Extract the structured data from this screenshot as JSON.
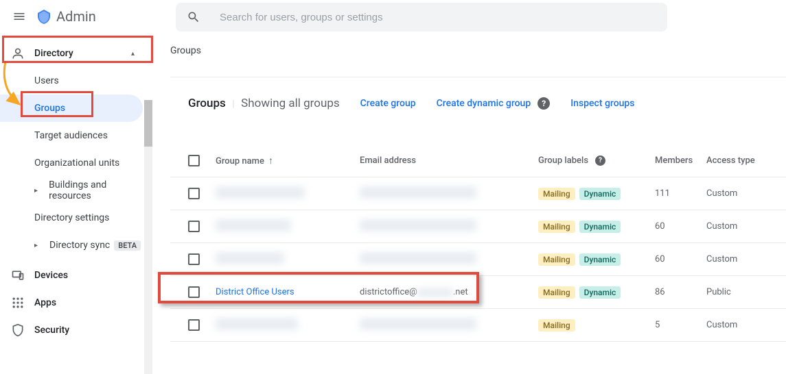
{
  "header": {
    "product": "Admin",
    "search_placeholder": "Search for users, groups or settings"
  },
  "sidebar": {
    "top": {
      "label": "Directory"
    },
    "items": [
      {
        "label": "Users"
      },
      {
        "label": "Groups"
      },
      {
        "label": "Target audiences"
      },
      {
        "label": "Organizational units"
      },
      {
        "label": "Buildings and resources"
      },
      {
        "label": "Directory settings"
      },
      {
        "label": "Directory sync",
        "badge": "BETA"
      }
    ],
    "sections": [
      {
        "label": "Devices"
      },
      {
        "label": "Apps"
      },
      {
        "label": "Security"
      }
    ]
  },
  "content": {
    "breadcrumb": "Groups",
    "title": "Groups",
    "subtitle": "Showing all groups",
    "actions": {
      "create": "Create group",
      "create_dynamic": "Create dynamic group",
      "inspect": "Inspect groups"
    },
    "columns": {
      "name": "Group name",
      "email": "Email address",
      "labels": "Group labels",
      "members": "Members",
      "access": "Access type"
    },
    "labels": {
      "mailing": "Mailing",
      "dynamic": "Dynamic"
    },
    "rows": [
      {
        "name": "",
        "email": "",
        "mailing": true,
        "dynamic": true,
        "members": "111",
        "access": "Custom",
        "blurred": true
      },
      {
        "name": "",
        "email": "",
        "mailing": true,
        "dynamic": true,
        "members": "60",
        "access": "Custom",
        "blurred": true
      },
      {
        "name": "",
        "email": "",
        "mailing": true,
        "dynamic": true,
        "members": "60",
        "access": "Custom",
        "blurred": true
      },
      {
        "name": "District Office Users",
        "email_prefix": "districtoffice@",
        "email_suffix": ".net",
        "mailing": true,
        "dynamic": true,
        "members": "86",
        "access": "Public",
        "blurred": false,
        "highlighted": true
      },
      {
        "name": "",
        "email": "",
        "mailing": true,
        "dynamic": false,
        "members": "5",
        "access": "Custom",
        "blurred": true
      }
    ]
  }
}
